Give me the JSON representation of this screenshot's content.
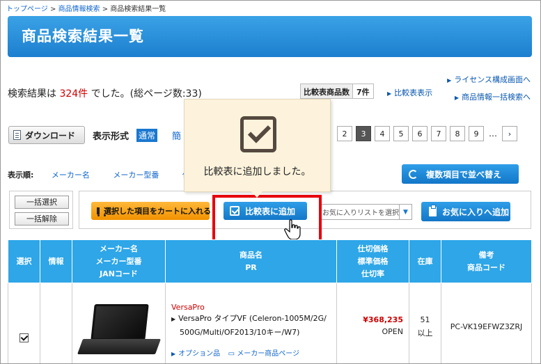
{
  "breadcrumb": {
    "items": [
      "トップページ",
      "商品情報検索",
      "商品検索結果一覧"
    ],
    "separator": " > "
  },
  "page_title": "商品検索結果一覧",
  "right_links": {
    "license": "ライセンス構成画面へ",
    "compare_table": "比較表表示",
    "bulk_search": "商品情報一括検索へ"
  },
  "result_summary": {
    "prefix": "検索結果は",
    "count": "324件",
    "suffix": "でした。(総ページ数:33)"
  },
  "compare_counter": {
    "label": "比較表商品数",
    "count": "7件"
  },
  "download_button": "ダウンロード",
  "display_format": {
    "label": "表示形式",
    "normal": "通常",
    "simple": "簡"
  },
  "pager": {
    "pages": [
      "2",
      "3",
      "4",
      "5",
      "6",
      "7",
      "8",
      "9"
    ],
    "current": "3",
    "dots": "…",
    "next": "›"
  },
  "sort": {
    "label": "表示順:",
    "options": [
      "メーカー名",
      "メーカー型番",
      "仕"
    ]
  },
  "multi_sort_button": "複数項目で並べ替え",
  "select_all": "一括選択",
  "deselect_all": "一括解除",
  "add_to_cart": "選択した項目をカートに入れる",
  "add_to_compare": "比較表に追加",
  "favorite_list_select": {
    "placeholder": "お気に入りリストを選択"
  },
  "add_to_favorite": "お気に入りへ追加",
  "popup": {
    "message": "比較表に追加しました。"
  },
  "table": {
    "headers": {
      "select": "選択",
      "info": "情報",
      "maker": [
        "メーカー名",
        "メーカー型番",
        "JANコード"
      ],
      "product": [
        "商品名",
        "PR"
      ],
      "price": [
        "仕切価格",
        "標準価格",
        "仕切率"
      ],
      "stock": "在庫",
      "note": [
        "備考",
        "商品コード"
      ]
    },
    "rows": [
      {
        "checked": true,
        "brand": "VersaPro",
        "name_line1": "VersaPro タイプVF (Celeron-1005M/2G/",
        "name_line2": "500G/Multi/OF2013/10キー/W7)",
        "option_link": "オプション品",
        "maker_page_link": "メーカー商品ページ",
        "price": "¥368,235",
        "list_price": "OPEN",
        "stock_line1": "51",
        "stock_line2": "以上",
        "product_code": "PC-VK19EFWZ3ZRJ"
      }
    ]
  },
  "colors": {
    "accent_blue": "#1a78d0",
    "header_blue": "#2ea6e8",
    "orange": "#f19200",
    "highlight_red": "#e8000d",
    "count_red": "#cc0000",
    "popup_bg": "#fdf3dc"
  },
  "icons": [
    "document-icon",
    "sync-icon",
    "cart-icon",
    "checkbox-icon",
    "clipboard-icon",
    "pointer-hand-icon",
    "big-check-icon"
  ]
}
